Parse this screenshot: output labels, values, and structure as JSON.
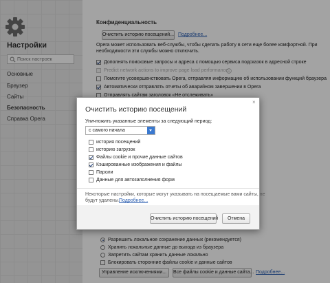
{
  "sidebar": {
    "title": "Настройки",
    "search_placeholder": "Поиск настроек",
    "items": [
      {
        "label": "Основные"
      },
      {
        "label": "Браузер"
      },
      {
        "label": "Сайты"
      },
      {
        "label": "Безопасность"
      },
      {
        "label": "Справка Opera"
      }
    ]
  },
  "privacy": {
    "title": "Конфиденциальность",
    "clear_button": "Очистить историю посещений...",
    "more_link": "Подробнее...",
    "desc_line1": "Opera может использовать веб-службы, чтобы сделать работу в сети еще более комфортной. При",
    "desc_line2": "необходимости эти службы можно отключить.",
    "options": [
      {
        "label": "Дополнять поисковые запросы и адреса с помощью сервиса подсказок в адресной строке",
        "checked": true
      },
      {
        "label": "Predict network actions to improve page load performance",
        "checked": false
      },
      {
        "label": "Помогите усовершенствовать Opera, отправляя информацию об использовании функций браузера",
        "checked": false
      },
      {
        "label": "Автоматически отправлять отчеты об аварийном завершении в Opera",
        "checked": true
      },
      {
        "label": "Отправлять сайтам заголовок «Не отслеживать»",
        "checked": false
      }
    ]
  },
  "cookies": {
    "options": [
      {
        "label": "Разрешить локальное сохранение данных (рекомендуется)",
        "selected": true
      },
      {
        "label": "Хранить локальные данные до выхода из браузера",
        "selected": false
      },
      {
        "label": "Запретить сайтам хранить данные локально",
        "selected": false
      }
    ],
    "block_third_party": "Блокировать сторонние файлы cookie и данные сайтов",
    "manage_button": "Управление исключениями...",
    "all_cookies_button": "Все файлы cookie и данные сайта...",
    "more_link": "Подробнее..."
  },
  "dialog": {
    "title": "Очистить историю посещений",
    "close_icon": "×",
    "period_label": "Уничтожить указанные элементы за следующий период:",
    "period_value": "с самого начала",
    "items": [
      {
        "label": "история посещений",
        "checked": false
      },
      {
        "label": "историю загрузок",
        "checked": false
      },
      {
        "label": "Файлы cookie и прочие данные сайтов",
        "checked": true
      },
      {
        "label": "Кэшированные изображения и файлы",
        "checked": true
      },
      {
        "label": "Пароли",
        "checked": false
      },
      {
        "label": "Данные для автозаполнения форм",
        "checked": false
      }
    ],
    "note_line1": "Некоторые настройки, которые могут указывать на посещаемые вами сайты, не",
    "note_line2": "будут удалены.",
    "note_link": "Подробнее...",
    "confirm_button": "Очистить историю посещений",
    "cancel_button": "Отмена"
  }
}
